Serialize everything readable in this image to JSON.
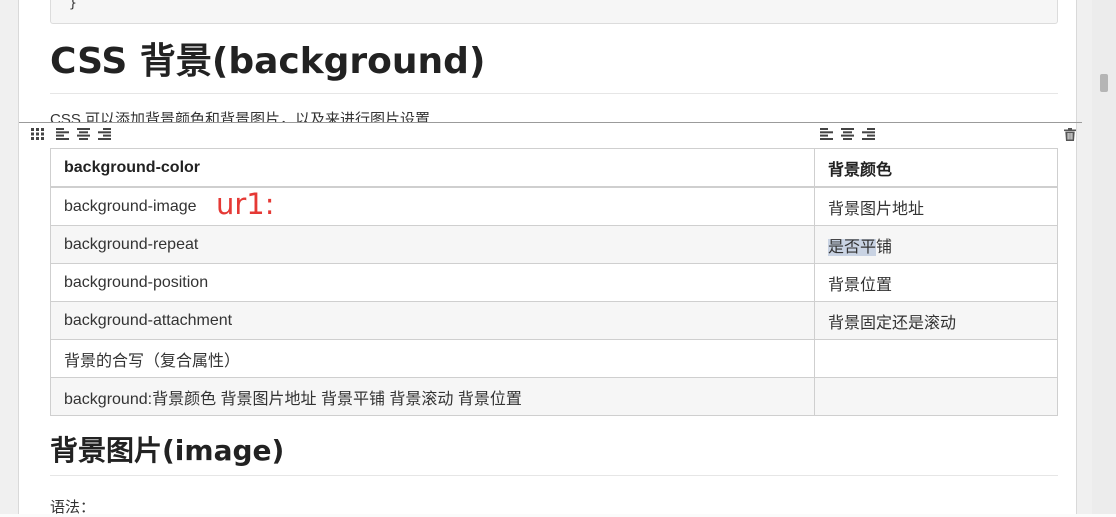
{
  "code": {
    "closing": "}"
  },
  "heading": "CSS 背景(background)",
  "intro": "CSS 可以添加背景颜色和背景图片，以及来进行图片设置",
  "toolbar": {
    "icons": [
      "table-grid-icon",
      "align-left-icon",
      "align-center-icon",
      "align-right-icon",
      "align-left-icon",
      "align-center-icon",
      "align-right-icon",
      "trash-icon"
    ]
  },
  "table": {
    "header": [
      "background-color",
      "背景颜色"
    ],
    "rows": [
      [
        "background-image",
        "背景图片地址"
      ],
      [
        "background-repeat",
        "是否平铺"
      ],
      [
        "background-position",
        "背景位置"
      ],
      [
        "background-attachment",
        "背景固定还是滚动"
      ],
      [
        "背景的合写（复合属性）",
        ""
      ],
      [
        "background:背景颜色 背景图片地址 背景平铺 背景滚动 背景位置",
        ""
      ]
    ],
    "highlighted_cell": "是否平",
    "highlighted_rest": "铺"
  },
  "annotation": "ur1:",
  "annotation_color": "#e53935",
  "subheading": "背景图片(image)",
  "syntax_label": "语法："
}
